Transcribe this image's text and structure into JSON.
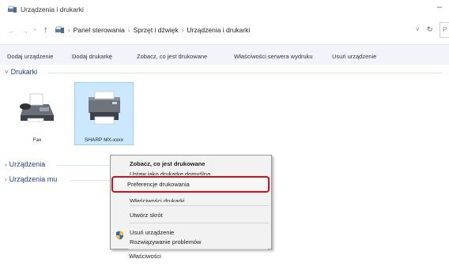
{
  "window": {
    "title": "Urządzenia i drukarki",
    "minimize_glyph": "–",
    "app_icon": "devices-and-printers-icon"
  },
  "addressbar": {
    "back_glyph": "←",
    "forward_glyph": "→",
    "recent_glyph": "˅",
    "up_glyph": "↑",
    "crumb_separator": "›",
    "breadcrumbs": [
      "Panel sterowania",
      "Sprzęt i dźwięk",
      "Urządzenia i drukarki"
    ],
    "dropdown_glyph": "˅",
    "refresh_glyph": "↻",
    "search_glyph": "P"
  },
  "commands": [
    "Dodaj urządzenie",
    "Dodaj drukarkę",
    "Zobacz, co jest drukowane",
    "Właściwości serwera wydruku",
    "Usuń urządzenie"
  ],
  "sections": {
    "printers": {
      "label": "Drukarki",
      "chevron": "˅"
    },
    "devices": {
      "label": "Urządzenia",
      "chevron": "›"
    },
    "media": {
      "label": "Urządzenia mu",
      "chevron": "›"
    }
  },
  "printers": [
    {
      "name": "Fax",
      "icon": "fax-icon",
      "selected": false
    },
    {
      "name": "SHARP MX-xxxx",
      "icon": "printer-icon",
      "selected": true
    }
  ],
  "context_menu": {
    "items": [
      {
        "label": "Zobacz, co jest drukowane",
        "bold": true
      },
      {
        "label": "Ustaw jako drukarkę domyślną",
        "partially_hidden": true
      },
      {
        "label": "Preferencje drukowania",
        "highlighted": true
      },
      {
        "label": "Właściwości drukarki",
        "partially_hidden": true
      },
      {
        "label": "Utwórz skrót"
      },
      {
        "label": "Usuń urządzenie",
        "icon": "shield-icon"
      },
      {
        "label": "Rozwiązywanie problemów"
      },
      {
        "label": "Właściwości"
      }
    ]
  },
  "colors": {
    "accent_text": "#1e3f8e",
    "selection_fill": "#cce8ff",
    "highlight_border": "#d0101b",
    "command_bar": "#f1f5fa"
  }
}
